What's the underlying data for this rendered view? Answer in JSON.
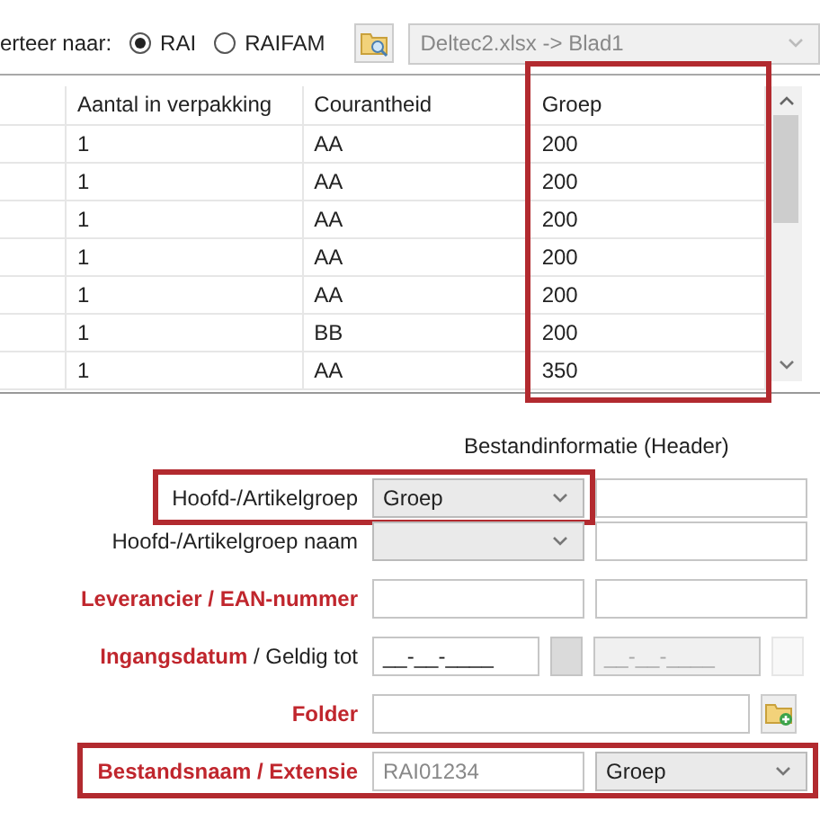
{
  "convert_bar": {
    "label": "erteer naar:",
    "options": [
      {
        "label": "RAI",
        "selected": true
      },
      {
        "label": "RAIFAM",
        "selected": false
      }
    ],
    "source": {
      "value": "Deltec2.xlsx -> Blad1",
      "disabled": true
    }
  },
  "table": {
    "columns": [
      {
        "label": "Aantal in verpakking",
        "highlighted": false
      },
      {
        "label": "Courantheid",
        "highlighted": false
      },
      {
        "label": "Groep",
        "highlighted": true
      }
    ],
    "rows": [
      [
        "1",
        "AA",
        "200"
      ],
      [
        "1",
        "AA",
        "200"
      ],
      [
        "1",
        "AA",
        "200"
      ],
      [
        "1",
        "AA",
        "200"
      ],
      [
        "1",
        "AA",
        "200"
      ],
      [
        "1",
        "BB",
        "200"
      ],
      [
        "1",
        "AA",
        "350"
      ]
    ]
  },
  "header_info": {
    "title": "Bestandinformatie (Header)",
    "rows": [
      {
        "label": "Hoofd-/Artikelgroep",
        "required": false,
        "highlighted": true,
        "controls": [
          {
            "kind": "combo",
            "value": "Groep"
          }
        ],
        "side_controls": [
          {
            "kind": "field"
          }
        ]
      },
      {
        "label": "Hoofd-/Artikelgroep naam",
        "required": false,
        "highlighted": false,
        "controls": [
          {
            "kind": "combo"
          },
          {
            "kind": "field"
          }
        ]
      },
      {
        "label": "Leverancier / EAN-nummer",
        "required": true,
        "highlighted": false,
        "controls": [
          {
            "kind": "field"
          },
          {
            "kind": "field"
          }
        ]
      },
      {
        "label": "**Ingangsdatum** / Geldig tot",
        "required": false,
        "highlighted": false,
        "controls": [
          {
            "kind": "date",
            "value": "__-__-____",
            "disabled": false
          },
          {
            "kind": "date-button",
            "disabled": false
          },
          {
            "kind": "date",
            "value": "__-__-____",
            "disabled": true
          },
          {
            "kind": "date-button",
            "disabled": true
          }
        ]
      },
      {
        "label": "Folder",
        "required": true,
        "highlighted": false,
        "controls": [
          {
            "kind": "wide-field"
          },
          {
            "kind": "folder-button"
          }
        ]
      },
      {
        "label": "Bestandsnaam / Extensie",
        "required": true,
        "highlighted": true,
        "controls": [
          {
            "kind": "readonly-field",
            "value": "RAI01234"
          },
          {
            "kind": "combo",
            "value": "Groep"
          }
        ]
      }
    ]
  }
}
